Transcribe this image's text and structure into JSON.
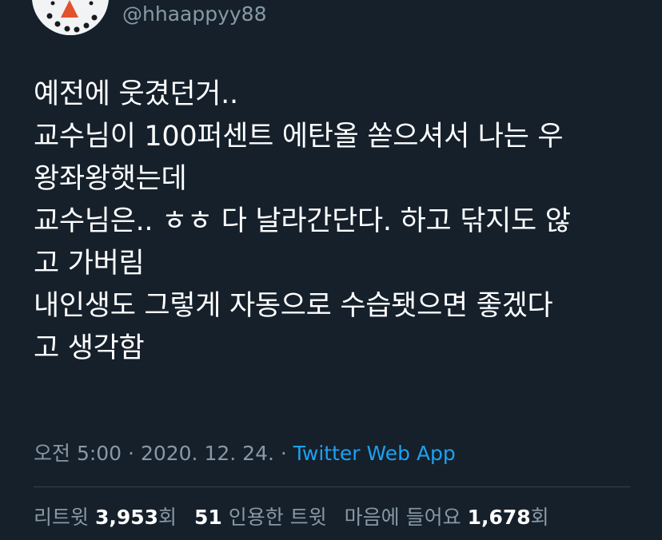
{
  "author": {
    "handle": "@hhaappyy88"
  },
  "tweet": {
    "lines": [
      "예전에 웃겼던거..",
      "교수님이 100퍼센트 에탄올 쏟으셔서 나는 우",
      "왕좌왕햇는데",
      "교수님은.. ㅎㅎ 다 날라간단다. 하고 닦지도 않",
      "고 가버림",
      "내인생도 그렇게 자동으로 수습됏으면 좋겠다",
      "고 생각함"
    ]
  },
  "meta": {
    "time": "오전 5:00",
    "separator": " · ",
    "date": "2020. 12. 24.",
    "separator2": " · ",
    "source": "Twitter Web App"
  },
  "stats": {
    "retweets_label": "리트윗",
    "retweets_count": "3,953",
    "retweets_suffix": "회",
    "quotes_count": "51",
    "quotes_label": "인용한 트윗",
    "likes_label": "마음에 들어요",
    "likes_count": "1,678",
    "likes_suffix": "회"
  },
  "colors": {
    "background": "#15202b",
    "secondary_text": "#8899a6",
    "link": "#1da1f2",
    "divider": "#38444d"
  },
  "icons": {
    "avatar": "snowman-avatar"
  }
}
